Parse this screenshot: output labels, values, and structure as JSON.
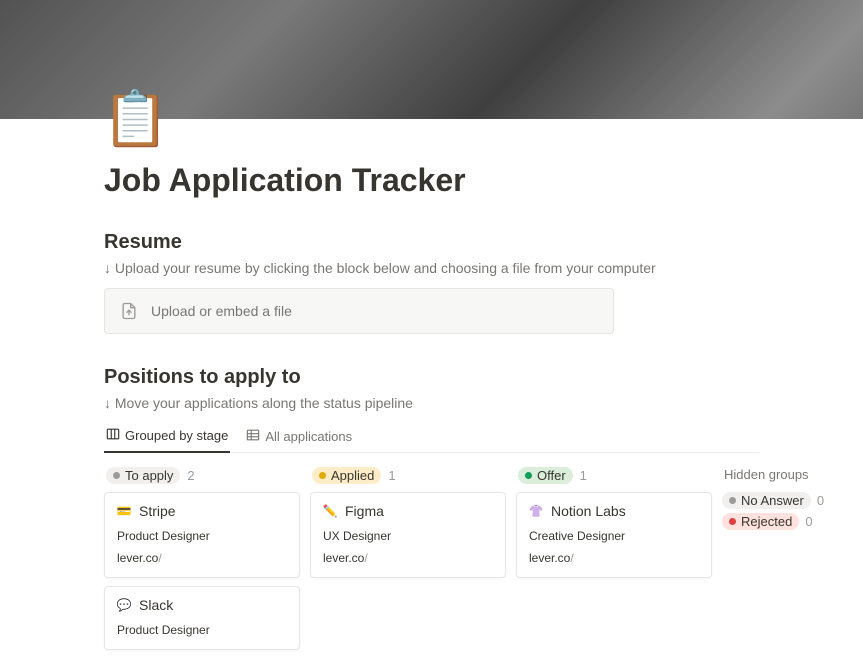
{
  "page": {
    "title": "Job Application Tracker",
    "icon_name": "clipboard-icon"
  },
  "resume": {
    "heading": "Resume",
    "help": "↓ Upload your resume by clicking the block below and choosing a file from your computer",
    "upload_label": "Upload or embed a file"
  },
  "positions": {
    "heading": "Positions to apply to",
    "help": "↓ Move your applications along the status pipeline"
  },
  "tabs": {
    "grouped": "Grouped by stage",
    "all": "All applications"
  },
  "columns": [
    {
      "status": "To apply",
      "count": "2",
      "color": "gray",
      "cards": [
        {
          "icon": "💳",
          "company": "Stripe",
          "role": "Product Designer",
          "link_host": "lever.co",
          "link_path": "/"
        },
        {
          "icon": "💬",
          "company": "Slack",
          "role": "Product Designer",
          "link_host": "",
          "link_path": ""
        }
      ]
    },
    {
      "status": "Applied",
      "count": "1",
      "color": "yellow",
      "cards": [
        {
          "icon": "✏️",
          "company": "Figma",
          "role": "UX Designer",
          "link_host": "lever.co",
          "link_path": "/"
        }
      ]
    },
    {
      "status": "Offer",
      "count": "1",
      "color": "green",
      "cards": [
        {
          "icon": "👚",
          "company": "Notion Labs",
          "role": "Creative Designer",
          "link_host": "lever.co",
          "link_path": "/"
        }
      ]
    }
  ],
  "hidden": {
    "title": "Hidden groups",
    "items": [
      {
        "status": "No Answer",
        "count": "0",
        "color": "gray"
      },
      {
        "status": "Rejected",
        "count": "0",
        "color": "red"
      }
    ]
  }
}
